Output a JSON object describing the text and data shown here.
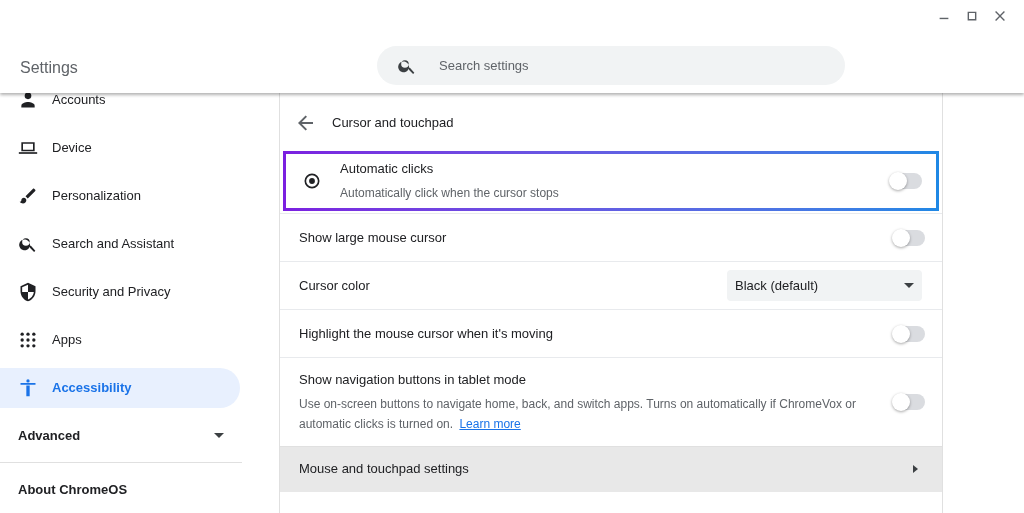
{
  "window": {
    "title": "Settings"
  },
  "search": {
    "placeholder": "Search settings"
  },
  "sidebar": {
    "items": [
      {
        "label": "Accounts",
        "selected": false
      },
      {
        "label": "Device",
        "selected": false
      },
      {
        "label": "Personalization",
        "selected": false
      },
      {
        "label": "Search and Assistant",
        "selected": false
      },
      {
        "label": "Security and Privacy",
        "selected": false
      },
      {
        "label": "Apps",
        "selected": false
      },
      {
        "label": "Accessibility",
        "selected": true
      }
    ],
    "advanced": {
      "label": "Advanced",
      "expanded": false
    },
    "about": "About ChromeOS"
  },
  "page": {
    "title": "Cursor and touchpad",
    "rows": [
      {
        "kind": "toggle",
        "label": "Automatic clicks",
        "description": "Automatically click when the cursor stops",
        "on": false,
        "highlighted": true
      },
      {
        "kind": "toggle",
        "label": "Show large mouse cursor",
        "on": false,
        "highlighted": false
      },
      {
        "kind": "select",
        "label": "Cursor color",
        "value": "Black (default)"
      },
      {
        "kind": "toggle",
        "label": "Highlight the mouse cursor when it's moving",
        "on": false,
        "highlighted": false
      },
      {
        "kind": "toggle",
        "label": "Show navigation buttons in tablet mode",
        "description": "Use on-screen buttons to navigate home, back, and switch apps. Turns on automatically if ChromeVox or automatic clicks is turned on.",
        "link": "Learn more",
        "on": false,
        "highlighted": false
      },
      {
        "kind": "submenu",
        "label": "Mouse and touchpad settings"
      }
    ]
  }
}
